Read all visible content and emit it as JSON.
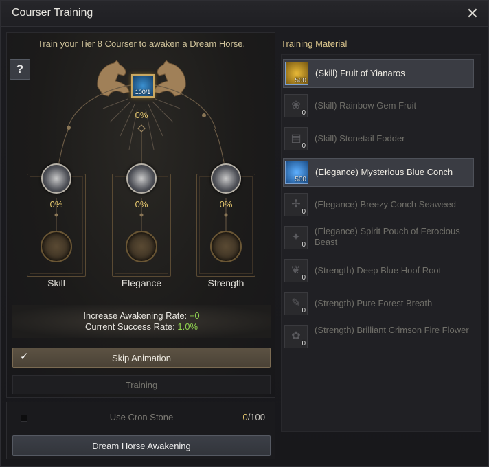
{
  "window": {
    "title": "Courser Training"
  },
  "left": {
    "subtitle": "Train your Tier 8 Courser to awaken a Dream Horse.",
    "help_label": "?",
    "center": {
      "count": "100/1",
      "percent": "0%"
    },
    "slots": [
      {
        "label": "Skill",
        "percent": "0%",
        "icon": "horse-skill-icon"
      },
      {
        "label": "Elegance",
        "percent": "0%",
        "icon": "horse-elegance-icon"
      },
      {
        "label": "Strength",
        "percent": "0%",
        "icon": "horse-strength-icon"
      }
    ],
    "rates": {
      "increase_label": "Increase Awakening Rate:",
      "increase_value": "+0",
      "success_label": "Current Success Rate:",
      "success_value": "1.0%"
    },
    "skip_animation_label": "Skip Animation",
    "training_label": "Training",
    "cron": {
      "label": "Use Cron Stone",
      "count": "0",
      "max": "/100"
    },
    "awaken_label": "Dream Horse Awakening"
  },
  "materials": {
    "title": "Training Material",
    "items": [
      {
        "name": "(Skill) Fruit of Yianaros",
        "qty": "500",
        "active": true,
        "icon": "fruit-icon"
      },
      {
        "name": "(Skill) Rainbow Gem Fruit",
        "qty": "0",
        "active": false,
        "icon": "gem-fruit-icon"
      },
      {
        "name": "(Skill) Stonetail Fodder",
        "qty": "0",
        "active": false,
        "icon": "fodder-icon"
      },
      {
        "name": "(Elegance) Mysterious Blue Conch",
        "qty": "500",
        "active": true,
        "icon": "conch-icon"
      },
      {
        "name": "(Elegance) Breezy Conch Seaweed",
        "qty": "0",
        "active": false,
        "icon": "seaweed-icon"
      },
      {
        "name": "(Elegance) Spirit Pouch of Ferocious Beast",
        "qty": "0",
        "active": false,
        "icon": "pouch-icon"
      },
      {
        "name": "(Strength) Deep Blue Hoof Root",
        "qty": "0",
        "active": false,
        "icon": "hoof-root-icon"
      },
      {
        "name": "(Strength) Pure Forest Breath",
        "qty": "0",
        "active": false,
        "icon": "forest-breath-icon"
      },
      {
        "name": "(Strength) Brilliant Crimson Fire Flower",
        "qty": "0",
        "active": false,
        "icon": "fire-flower-icon"
      }
    ]
  },
  "colors": {
    "accent_gold": "#e6c86e",
    "success_green": "#8fd14f",
    "active_row": "#3a3c43"
  }
}
